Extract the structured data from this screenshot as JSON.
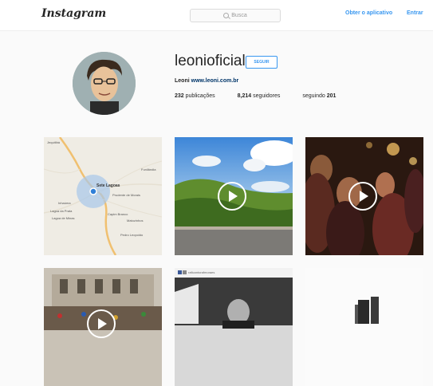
{
  "header": {
    "logo": "Instagram",
    "search_placeholder": "Busca",
    "get_app": "Obter o aplicativo",
    "login": "Entrar"
  },
  "profile": {
    "username": "leonioficial",
    "follow_label": "SEGUIR",
    "bio_name": "Leoni",
    "bio_link": "www.leoni.com.br",
    "posts_count": "232",
    "posts_label": "publicações",
    "followers_count": "8,214",
    "followers_label": "seguidores",
    "following_label": "seguindo",
    "following_count": "201"
  },
  "grid": {
    "map_labels": [
      "Sete Lagoas",
      "Prudente de Morais",
      "Capim Branco",
      "Matozinhos",
      "Pedro Leopoldo",
      "Funilândia",
      "Jequitibá",
      "Inhaúma",
      "Lagoa da Prata",
      "Lagoa de Minas"
    ],
    "post5_caption": "raficantorafmoraes"
  }
}
